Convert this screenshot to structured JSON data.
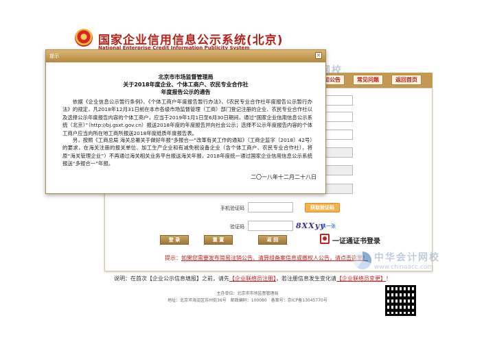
{
  "header": {
    "site_title": "国家企业信用信息公示系统(北京)",
    "site_title_en": "National Enterprise Credit Information Publicity System"
  },
  "watermark": {
    "cn": "中华会计网校",
    "en": "www.chinaacc.com"
  },
  "nav": {
    "tabs": [
      {
        "label": "通知公告"
      },
      {
        "label": "常见问题"
      },
      {
        "label": "返回首页"
      }
    ]
  },
  "form": {
    "phone_code_label": "手机验证码",
    "get_code_button": "获取验证码",
    "captcha_label": "验证码",
    "captcha_text": "8XXyy",
    "captcha_refresh": "换一张",
    "login_button": "登 录",
    "reset_button": "重 置",
    "back_button": "返 回",
    "cert_login": "一证通证书登录",
    "notice_prefix": "提示：",
    "notice_link": "如果您需要发布简易注销公告、清算组备案信息或撤权人公告，请点击这里！",
    "description_prefix": "说明：在首次【企业公示信息填报】之前，请先",
    "description_link1": "【企业联络员注册】",
    "description_middle": "，若注册信息发生变化请",
    "description_link2": "【企业联络员变更】",
    "description_suffix": "！"
  },
  "footer": {
    "line1": "主办单位：北京市市场监督管理局",
    "line2": "地址：北京市海淀区苏州街36号　邮政编码：100080　备案号：京ICP备13045770号"
  },
  "modal": {
    "header_title": "提示",
    "close_label": "×",
    "title_line1": "北京市市场监督管理局",
    "title_line2": "关于2018年度企业、个体工商户、农民专业合作社",
    "title_line3": "年度报告公示的通告",
    "para1": "依据《企业信息公示暂行条例》、《个体工商户年度报告暂行办法》、《农民专业合作社年度报告公示暂行办法》的规定，凡2018年12月31日前在本市各级市场监督管理（工商）部门登记注册的企业、农民专业合作社以及选择公示年度报告内容的个体工商户，应当于2019年1月1日至6月30日期间，通过“国家企业信用信息公示系统（北京）”（http://bj.gsxt.gov.cn）报送2018年度的年度报告并向社会公示；选择不公示年度报告内容的个体工商户应当向所在地工商所报送2018年度纸质年度报告表。",
    "para2": "另，按照《工商总局 海关总署关于做好年报“多报合一”改革有关工作的通知》（工商企监字〔2018〕42号）的要求，在海关注册的报关单位、加工生产企业和有减免税设备企业（含个体工商户、农民专业合作社），将原“海关管理企业”）不再通过海关相关业务平台报送海关年报，2018年度统一通过国家企业信用信息公示系统报送“多报合一”年报。",
    "date": "二〇一八年十二月二十八日"
  }
}
